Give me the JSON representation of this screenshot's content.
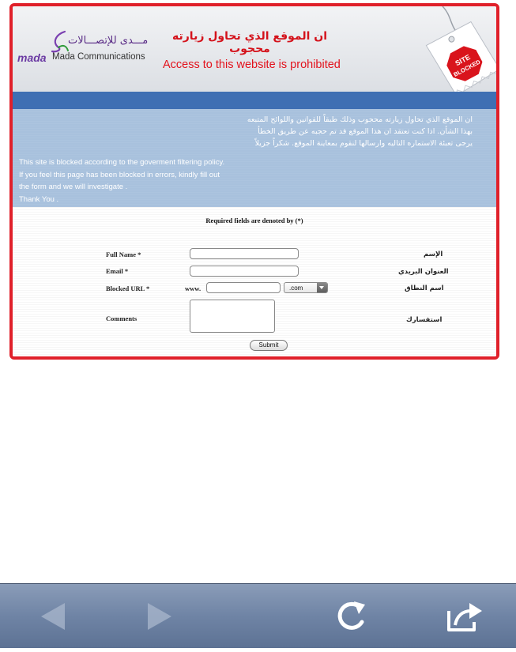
{
  "header": {
    "logo_arabic": "مـــدى للإتصـــالات",
    "logo_mada": "mada",
    "logo_company": "Mada Communications",
    "title_arabic": "ان الموقع الذي تحاول زيارته محجوب",
    "title_english": "Access to this website is prohibited",
    "tag_text": "SITE BLOCKED"
  },
  "notice": {
    "arabic_lines": [
      "ان الموقع الذي تحاول زيارته محجوب وذلك طبقاً للقوانين واللوائح المتبعه",
      "بهذا الشأن. اذا كنت تعتقد ان هذا الموقع قد تم حجبه عن طريق الخطأ",
      "يرجى تعبئة الاستماره التاليه وارسالها لنقوم بمعاينة الموقع. شكراً جزيلاً"
    ],
    "english_lines": [
      "This site is blocked according to the goverment filtering policy.",
      "If you feel this page has been blocked in errors, kindly  fill out",
      "the form and we will investigate .",
      "Thank You ."
    ]
  },
  "form": {
    "required_note": "Required fields are denoted by (*)",
    "full_name_label": "Full Name *",
    "full_name_label_ar": "الإسم",
    "full_name_value": "",
    "email_label": "Email *",
    "email_label_ar": "العنوان البريدي",
    "email_value": "",
    "url_label": "Blocked URL *",
    "url_label_ar": "اسم النطاق",
    "url_prefix": "www.",
    "url_value": "",
    "tld_selected": ".com",
    "comments_label": "Comments",
    "comments_label_ar": "استفسارك",
    "comments_value": "",
    "submit_label": "Submit"
  },
  "toolbar": {
    "back_icon": "back-arrow-icon",
    "forward_icon": "forward-arrow-icon",
    "reload_icon": "reload-icon",
    "share_icon": "share-icon"
  },
  "colors": {
    "border_red": "#e0202a",
    "title_red": "#e3121c",
    "strip_blue": "#3f6fb3",
    "panel_blue": "#a8c1dd",
    "logo_purple": "#6b3aa3"
  }
}
